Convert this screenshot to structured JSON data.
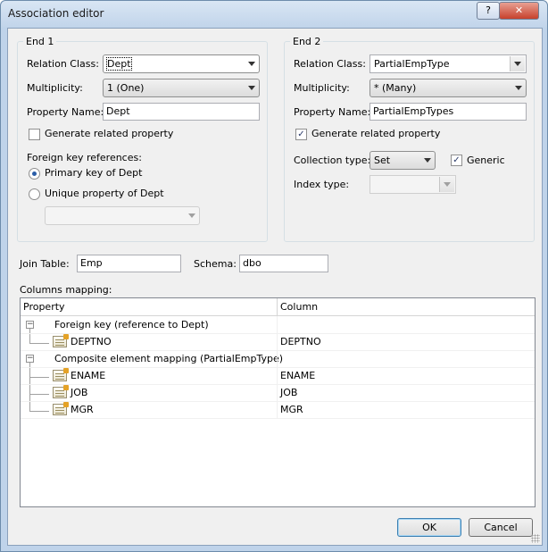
{
  "window": {
    "title": "Association editor",
    "help_glyph": "?",
    "close_glyph": "✕"
  },
  "end1": {
    "group_label": "End 1",
    "relation_class_label": "Relation Class:",
    "relation_class_value": "Dept",
    "multiplicity_label": "Multiplicity:",
    "multiplicity_value": "1 (One)",
    "property_name_label": "Property Name:",
    "property_name_value": "Dept",
    "generate_related_label": "Generate related property",
    "generate_related_checked": false,
    "fk_label": "Foreign key references:",
    "fk_primary_label": "Primary key of Dept",
    "fk_unique_label": "Unique property of Dept",
    "fk_selected": "primary",
    "unique_property_value": ""
  },
  "end2": {
    "group_label": "End 2",
    "relation_class_label": "Relation Class:",
    "relation_class_value": "PartialEmpType",
    "multiplicity_label": "Multiplicity:",
    "multiplicity_value": "* (Many)",
    "property_name_label": "Property Name:",
    "property_name_value": "PartialEmpTypes",
    "generate_related_label": "Generate related property",
    "generate_related_checked": true,
    "collection_type_label": "Collection type:",
    "collection_type_value": "Set",
    "generic_label": "Generic",
    "generic_checked": true,
    "index_type_label": "Index type:",
    "index_type_value": ""
  },
  "join": {
    "join_table_label": "Join Table:",
    "join_table_value": "Emp",
    "schema_label": "Schema:",
    "schema_value": "dbo"
  },
  "mapping": {
    "label": "Columns mapping:",
    "col_property": "Property",
    "col_column": "Column",
    "groups": [
      {
        "label": "Foreign key (reference to Dept)",
        "expander": "−",
        "items": [
          {
            "property": "DEPTNO",
            "column": "DEPTNO"
          }
        ]
      },
      {
        "label": "Composite element mapping (PartialEmpType)",
        "expander": "−",
        "items": [
          {
            "property": "ENAME",
            "column": "ENAME"
          },
          {
            "property": "JOB",
            "column": "JOB"
          },
          {
            "property": "MGR",
            "column": "MGR"
          }
        ]
      }
    ]
  },
  "buttons": {
    "ok": "OK",
    "cancel": "Cancel"
  },
  "check_glyph": "✓"
}
